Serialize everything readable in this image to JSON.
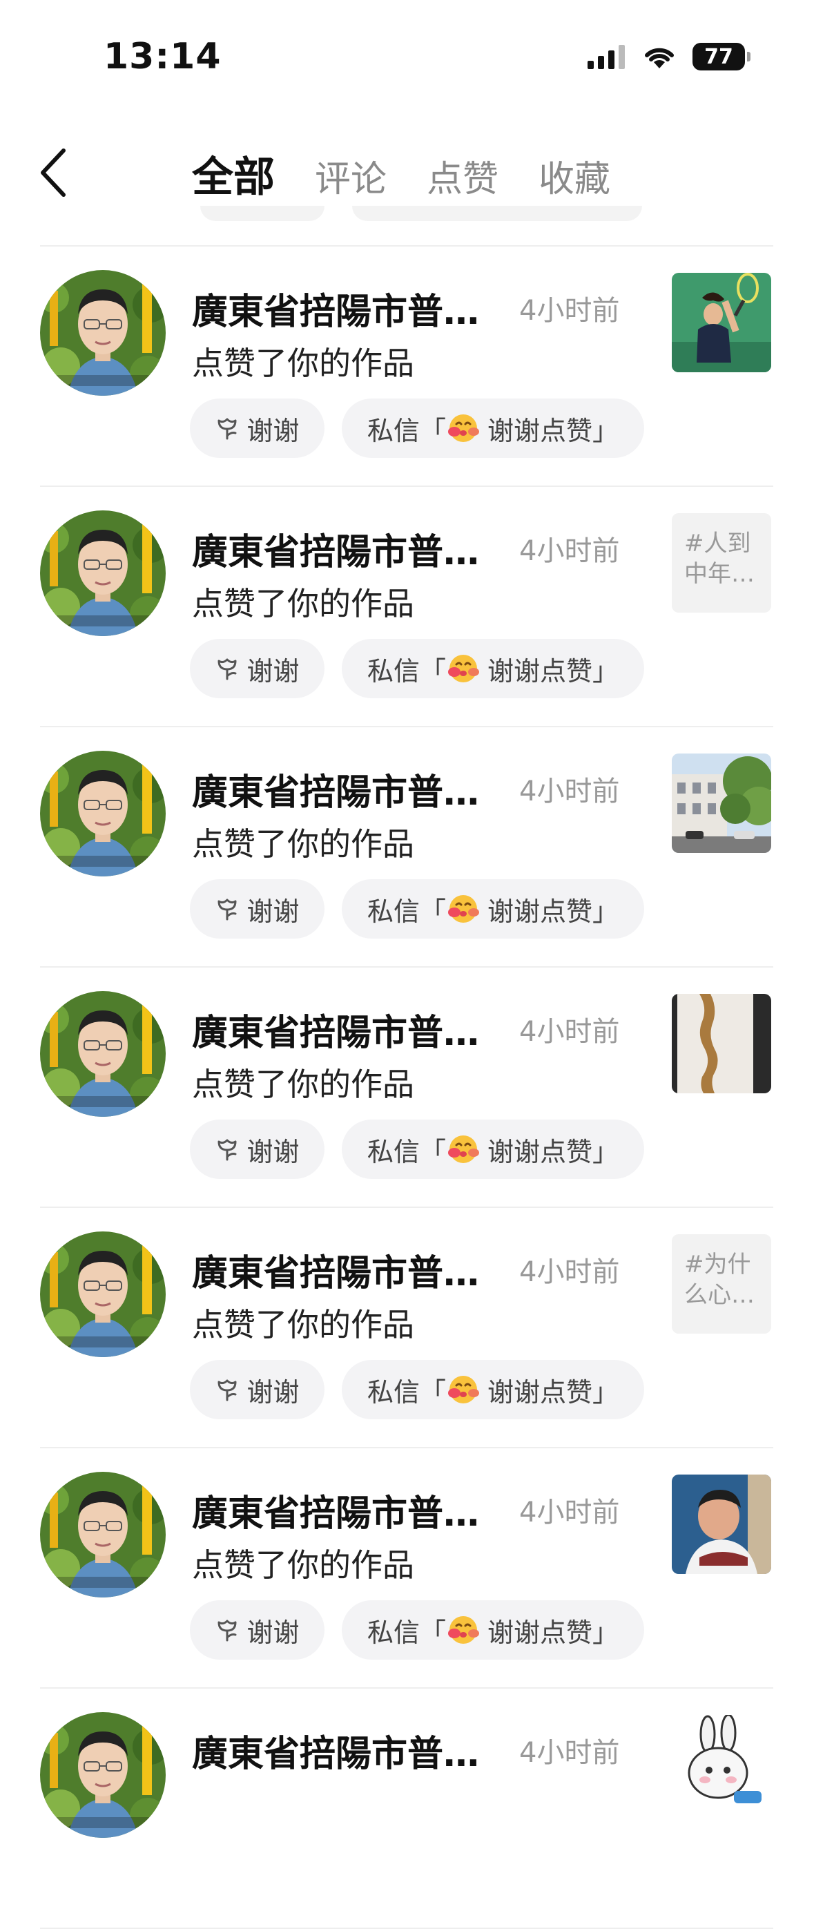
{
  "status": {
    "time": "13:14",
    "battery": "77"
  },
  "tabs": [
    "全部",
    "评论",
    "点赞",
    "收藏"
  ],
  "notifications": [
    {
      "name": "廣東省掊陽市普…",
      "time": "4小时前",
      "action": "点赞了你的作品",
      "thanks": "谢谢",
      "dm_prefix": "私信「",
      "dm_text": "谢谢点赞」",
      "thumb_kind": "image",
      "thumb_icon": "tennis-player-thumbnail",
      "thumb_lines": []
    },
    {
      "name": "廣東省掊陽市普…",
      "time": "4小时前",
      "action": "点赞了你的作品",
      "thanks": "谢谢",
      "dm_prefix": "私信「",
      "dm_text": "谢谢点赞」",
      "thumb_kind": "text",
      "thumb_icon": "",
      "thumb_lines": [
        "#人到",
        "中年…"
      ]
    },
    {
      "name": "廣東省掊陽市普…",
      "time": "4小时前",
      "action": "点赞了你的作品",
      "thanks": "谢谢",
      "dm_prefix": "私信「",
      "dm_text": "谢谢点赞」",
      "thumb_kind": "image",
      "thumb_icon": "street-building-thumbnail",
      "thumb_lines": []
    },
    {
      "name": "廣東省掊陽市普…",
      "time": "4小时前",
      "action": "点赞了你的作品",
      "thanks": "谢谢",
      "dm_prefix": "私信「",
      "dm_text": "谢谢点赞」",
      "thumb_kind": "image",
      "thumb_icon": "paper-object-thumbnail",
      "thumb_lines": []
    },
    {
      "name": "廣東省掊陽市普…",
      "time": "4小时前",
      "action": "点赞了你的作品",
      "thanks": "谢谢",
      "dm_prefix": "私信「",
      "dm_text": "谢谢点赞」",
      "thumb_kind": "text",
      "thumb_icon": "",
      "thumb_lines": [
        "#为什",
        "么心…"
      ]
    },
    {
      "name": "廣東省掊陽市普…",
      "time": "4小时前",
      "action": "点赞了你的作品",
      "thanks": "谢谢",
      "dm_prefix": "私信「",
      "dm_text": "谢谢点赞」",
      "thumb_kind": "image",
      "thumb_icon": "man-portrait-thumbnail",
      "thumb_lines": []
    },
    {
      "name": "廣東省掊陽市普…",
      "time": "4小时前",
      "action": "",
      "thanks": "",
      "dm_prefix": "",
      "dm_text": "",
      "thumb_kind": "image",
      "thumb_icon": "rabbit-cartoon-thumbnail",
      "thumb_lines": []
    }
  ],
  "colors": {
    "button_bg": "#f3f3f5",
    "muted_text": "#999999",
    "separator": "#eeeeee"
  }
}
